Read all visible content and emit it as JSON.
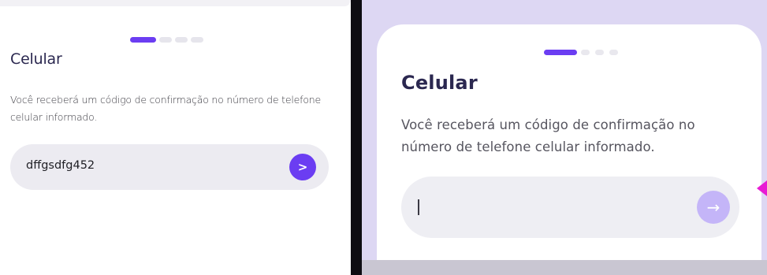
{
  "left_panel": {
    "title": "Celular",
    "description": "Você receberá um código de confirmação no número de telefone celular informado.",
    "input": {
      "value": "dffgsdfg452"
    },
    "submit": {
      "label": ">"
    },
    "steps": {
      "total": 4,
      "active": 1
    }
  },
  "right_panel": {
    "title": "Celular",
    "description": "Você receberá um código de confirmação no número de telefone celular informado.",
    "input": {
      "value": ""
    },
    "submit": {
      "icon": "arrow-right-icon",
      "glyph": "→",
      "state": "disabled"
    },
    "steps": {
      "total": 4,
      "active": 1
    }
  },
  "colors": {
    "accent": "#6b3df2",
    "accent_disabled": "#c4b5f8",
    "title": "#2b2850",
    "input_bg": "#ecebf1",
    "right_backdrop": "#ddd7f3",
    "marker": "#e81cd4"
  }
}
